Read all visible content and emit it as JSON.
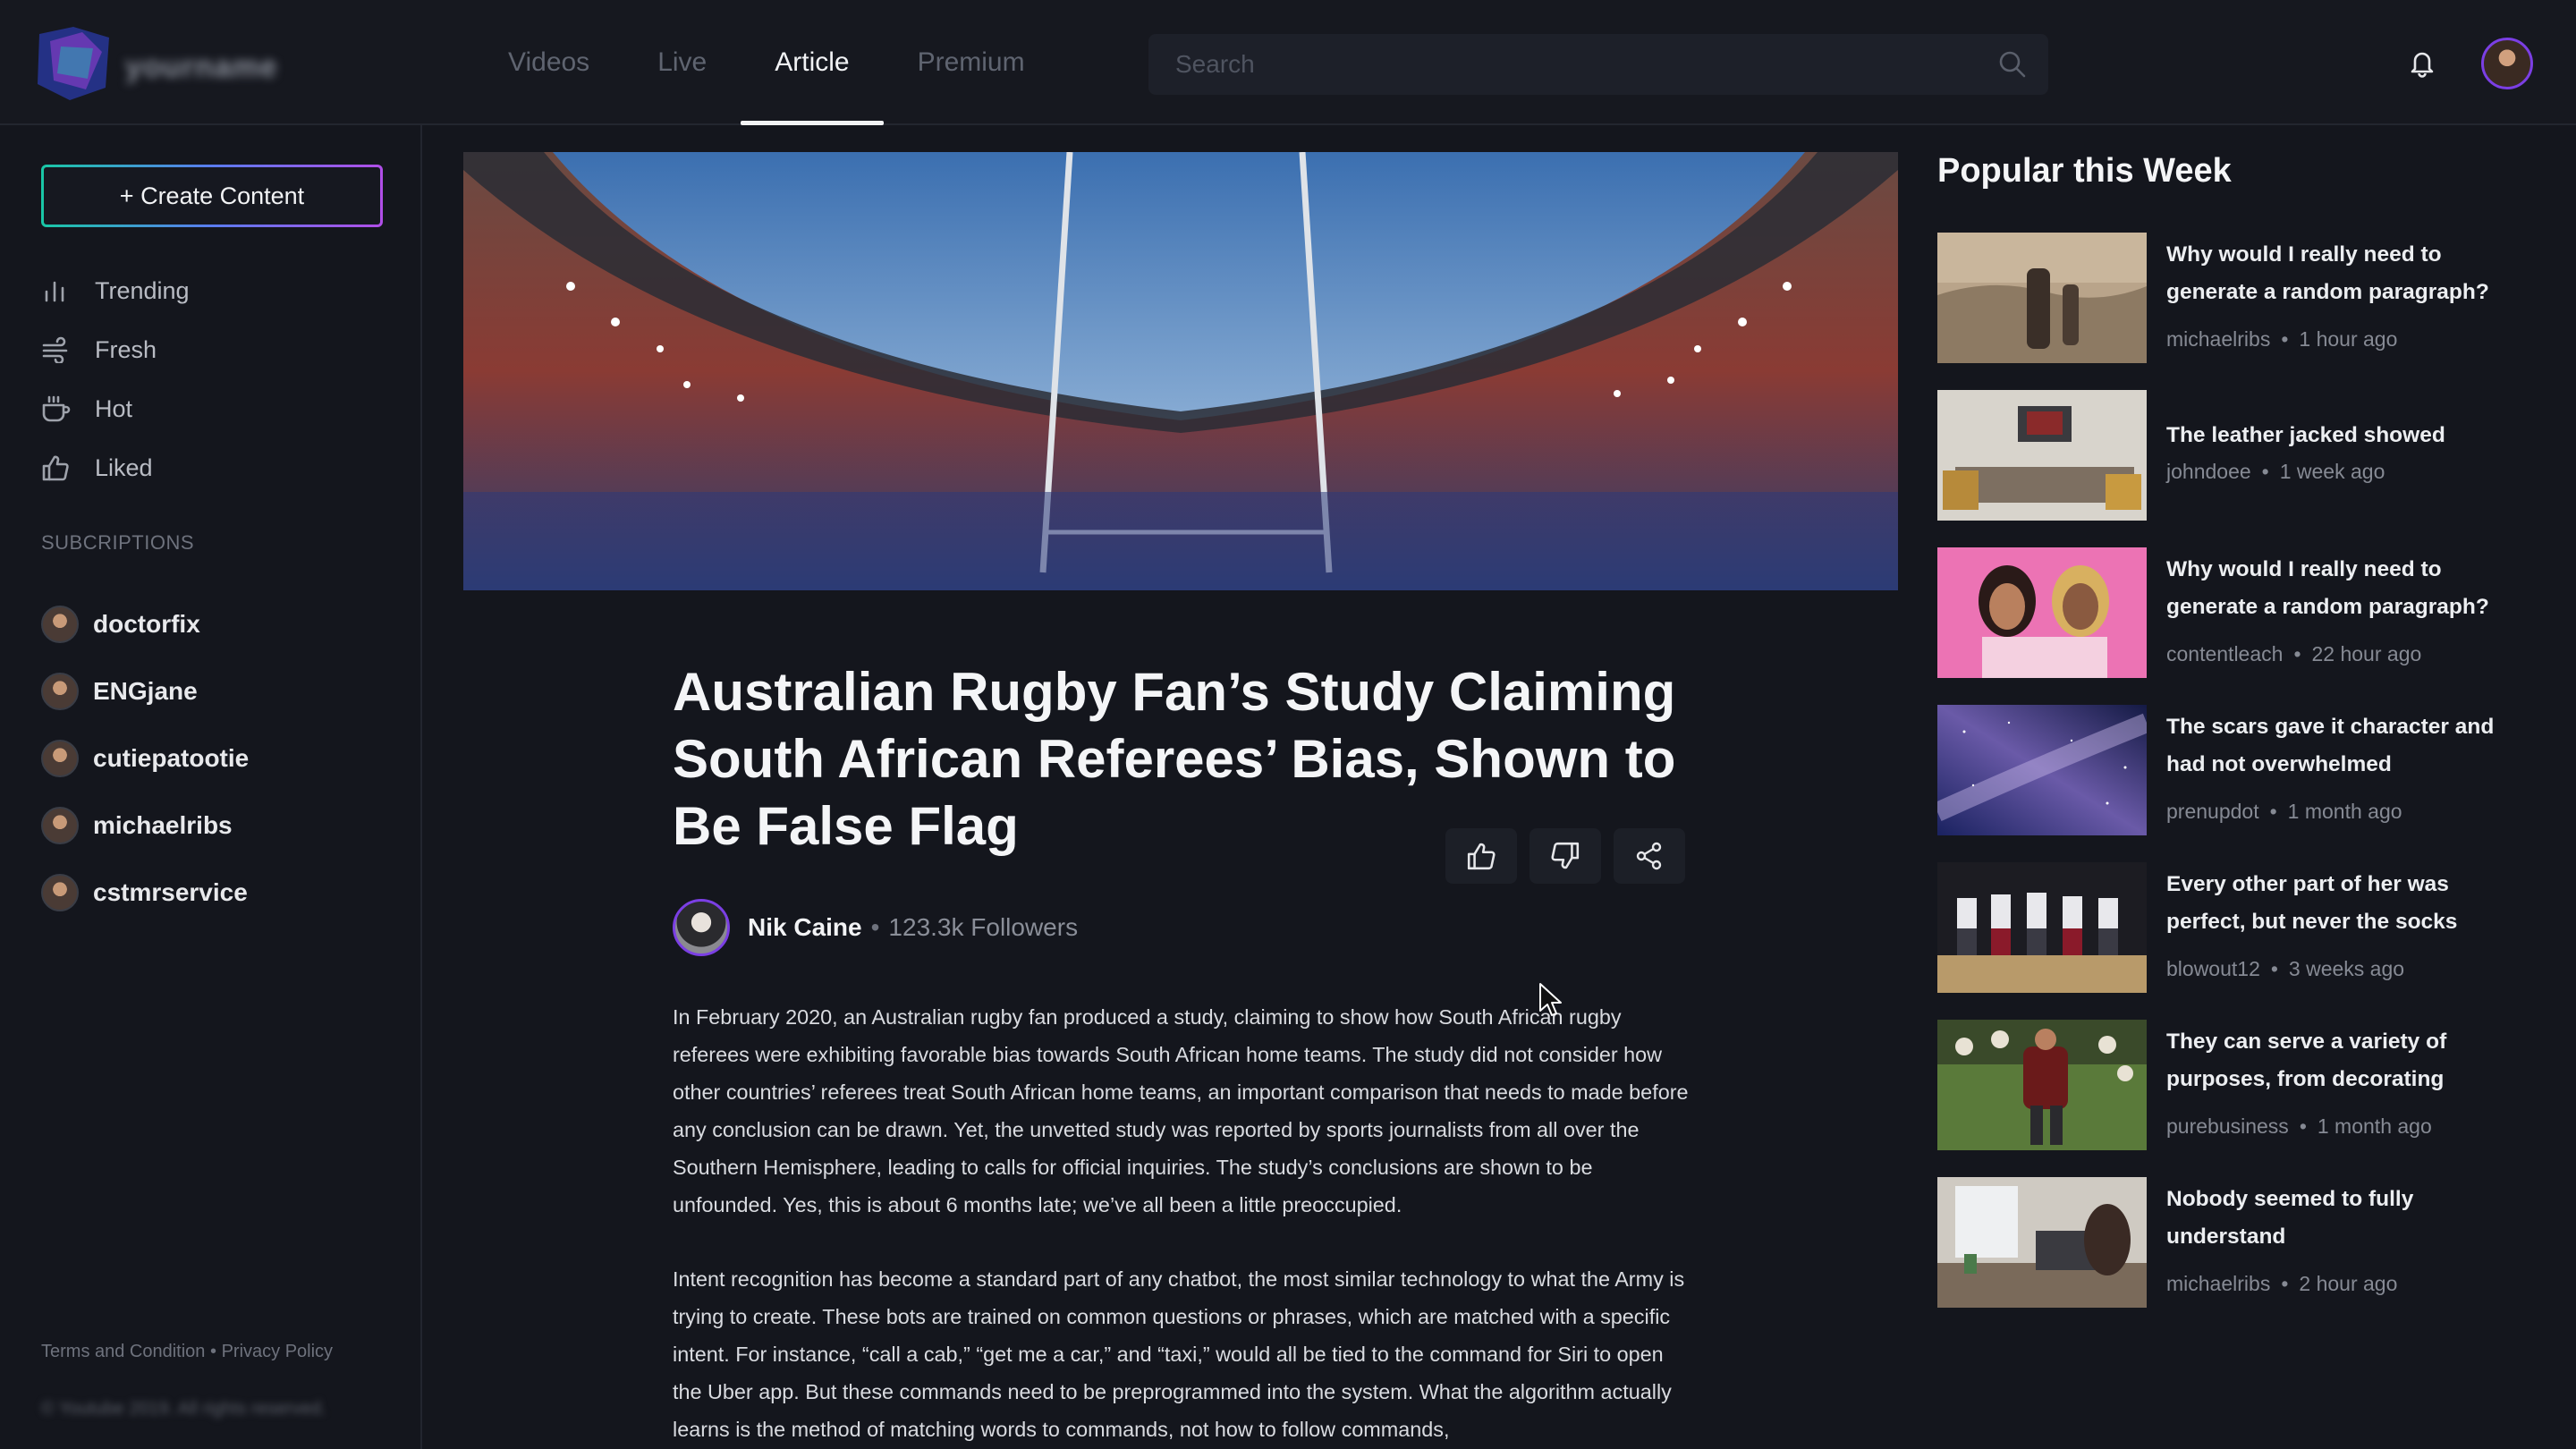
{
  "header": {
    "logo_text": "yourname",
    "tabs": [
      {
        "label": "Videos"
      },
      {
        "label": "Live"
      },
      {
        "label": "Article"
      },
      {
        "label": "Premium"
      }
    ],
    "search_placeholder": "Search"
  },
  "sidebar": {
    "create_label": "+ Create Content",
    "menu": [
      {
        "label": "Trending",
        "icon": "bar-chart-icon"
      },
      {
        "label": "Fresh",
        "icon": "wind-icon"
      },
      {
        "label": "Hot",
        "icon": "coffee-cup-icon"
      },
      {
        "label": "Liked",
        "icon": "thumbs-up-icon"
      }
    ],
    "subscriptions_title": "SUBCRIPTIONS",
    "subscriptions": [
      {
        "name": "doctorfix"
      },
      {
        "name": "ENGjane"
      },
      {
        "name": "cutiepatootie"
      },
      {
        "name": "michaelribs"
      },
      {
        "name": "cstmrservice"
      }
    ],
    "terms_label": "Terms and Condition",
    "footer_sep": "•",
    "privacy_label": "Privacy Policy",
    "copyright": "© Youtube 2019. All rights reserved."
  },
  "article": {
    "title": "Australian Rugby Fan’s Study Claiming South African Referees’ Bias, Shown to Be False Flag",
    "author_name": "Nik Caine",
    "author_sep": "•",
    "author_followers": "123.3k Followers",
    "paragraph_1": "In February 2020, an Australian rugby fan produced a study, claiming to show how South African rugby referees were exhibiting favorable bias towards South African home teams. The study did not consider how other countries’ referees treat South African home teams, an important comparison that needs to made before any conclusion can be drawn. Yet, the unvetted study was reported by sports journalists from all over the Southern Hemisphere, leading to calls for official inquiries. The study’s conclusions are shown to be unfounded. Yes, this is about 6 months late; we’ve all been a little preoccupied.",
    "paragraph_2": "Intent recognition has become a standard part of any chatbot, the most similar technology to what the Army is trying to create. These bots are trained on common questions or phrases, which are matched with a specific intent. For instance, “call a cab,” “get me a car,” and “taxi,” would all be tied to the command for Siri to open the Uber app. But these commands need to be preprogrammed into the system. What the algorithm actually learns is the method of matching words to commands, not how to follow commands,"
  },
  "popular": {
    "title": "Popular this Week",
    "items": [
      {
        "title": "Why would I really need to generate a random paragraph?",
        "author": "michaelribs",
        "time": "1 hour ago"
      },
      {
        "title": "The leather jacked showed",
        "author": "johndoee",
        "time": "1 week ago"
      },
      {
        "title": "Why would I really need to generate a random paragraph?",
        "author": "contentleach",
        "time": "22 hour ago"
      },
      {
        "title": "The scars gave it character and had not overwhelmed",
        "author": "prenupdot",
        "time": "1 month ago"
      },
      {
        "title": "Every other part of her was perfect, but never the socks",
        "author": "blowout12",
        "time": "3 weeks ago"
      },
      {
        "title": "They can serve a variety of purposes, from decorating",
        "author": "purebusiness",
        "time": "1 month ago"
      },
      {
        "title": "Nobody seemed to fully understand",
        "author": "michaelribs",
        "time": "2 hour ago"
      }
    ],
    "separator": "•"
  },
  "colors": {
    "background": "#14161d",
    "accent_purple": "#7b3fe4",
    "accent_teal": "#19c7a6",
    "text_primary": "#f4f5f7",
    "text_muted": "#868a94"
  }
}
